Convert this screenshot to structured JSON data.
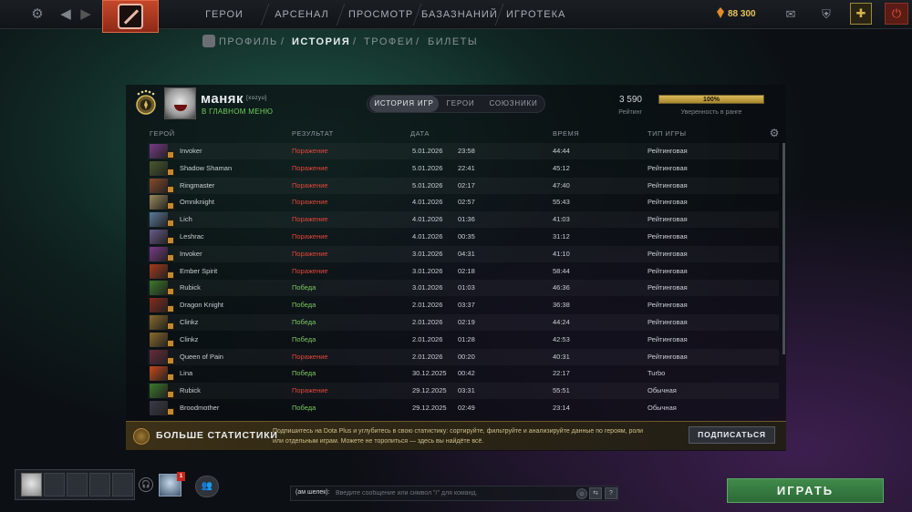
{
  "topbar": {
    "nav": [
      "ГЕРОИ",
      "АРСЕНАЛ",
      "ПРОСМОТР",
      "БАЗАЗНАНИЙ",
      "ИГРОТЕКА"
    ],
    "shards_value": "88 300",
    "icons": [
      "settings-icon",
      "back-icon",
      "dota-logo",
      "mail-icon",
      "inventory-icon",
      "dota-plus-icon",
      "power-icon"
    ]
  },
  "subnav": {
    "items": [
      "ПРОФИЛЬ",
      "ИСТОРИЯ",
      "ТРОФЕИ",
      "БИЛЕТЫ"
    ],
    "separator": "/",
    "active": "ИСТОРИЯ"
  },
  "profile": {
    "name": "маняк",
    "tag": "[xozyu]",
    "status": "В ГЛАВНОМ МЕНЮ",
    "rating": "3 590",
    "rating_label": "Рейтинг",
    "confidence": "100%",
    "confidence_value": 100,
    "confidence_label": "Уверенность в ранге"
  },
  "tabs": [
    "ИСТОРИЯ ИГР",
    "ГЕРОИ",
    "СОЮЗНИКИ"
  ],
  "table": {
    "headers": [
      "ГЕРОЙ",
      "РЕЗУЛЬТАТ",
      "ДАТА",
      "ВРЕМЯ",
      "ТИП ИГРЫ"
    ],
    "rows": [
      {
        "hero": "Invoker",
        "result": "Поражение",
        "date": "5.01.2026",
        "time": "23:58",
        "duration": "44:44",
        "type": "Рейтинговая",
        "win": false
      },
      {
        "hero": "Shadow Shaman",
        "result": "Поражение",
        "date": "5.01.2026",
        "time": "22:41",
        "duration": "45:12",
        "type": "Рейтинговая",
        "win": false
      },
      {
        "hero": "Ringmaster",
        "result": "Поражение",
        "date": "5.01.2026",
        "time": "02:17",
        "duration": "47:40",
        "type": "Рейтинговая",
        "win": false
      },
      {
        "hero": "Omniknight",
        "result": "Поражение",
        "date": "4.01.2026",
        "time": "02:57",
        "duration": "55:43",
        "type": "Рейтинговая",
        "win": false
      },
      {
        "hero": "Lich",
        "result": "Поражение",
        "date": "4.01.2026",
        "time": "01:36",
        "duration": "41:03",
        "type": "Рейтинговая",
        "win": false
      },
      {
        "hero": "Leshrac",
        "result": "Поражение",
        "date": "4.01.2026",
        "time": "00:35",
        "duration": "31:12",
        "type": "Рейтинговая",
        "win": false
      },
      {
        "hero": "Invoker",
        "result": "Поражение",
        "date": "3.01.2026",
        "time": "04:31",
        "duration": "41:10",
        "type": "Рейтинговая",
        "win": false
      },
      {
        "hero": "Ember Spirit",
        "result": "Поражение",
        "date": "3.01.2026",
        "time": "02:18",
        "duration": "58:44",
        "type": "Рейтинговая",
        "win": false
      },
      {
        "hero": "Rubick",
        "result": "Победа",
        "date": "3.01.2026",
        "time": "01:03",
        "duration": "46:36",
        "type": "Рейтинговая",
        "win": true
      },
      {
        "hero": "Dragon Knight",
        "result": "Победа",
        "date": "2.01.2026",
        "time": "03:37",
        "duration": "36:38",
        "type": "Рейтинговая",
        "win": true
      },
      {
        "hero": "Clinkz",
        "result": "Победа",
        "date": "2.01.2026",
        "time": "02:19",
        "duration": "44:24",
        "type": "Рейтинговая",
        "win": true
      },
      {
        "hero": "Clinkz",
        "result": "Победа",
        "date": "2.01.2026",
        "time": "01:28",
        "duration": "42:53",
        "type": "Рейтинговая",
        "win": true
      },
      {
        "hero": "Queen of Pain",
        "result": "Поражение",
        "date": "2.01.2026",
        "time": "00:20",
        "duration": "40:31",
        "type": "Рейтинговая",
        "win": false
      },
      {
        "hero": "Lina",
        "result": "Победа",
        "date": "30.12.2025",
        "time": "00:42",
        "duration": "22:17",
        "type": "Turbo",
        "win": true
      },
      {
        "hero": "Rubick",
        "result": "Поражение",
        "date": "29.12.2025",
        "time": "03:31",
        "duration": "55:51",
        "type": "Обычная",
        "win": false
      },
      {
        "hero": "Broodmother",
        "result": "Победа",
        "date": "29.12.2025",
        "time": "02:49",
        "duration": "23:14",
        "type": "Обычная",
        "win": true
      }
    ]
  },
  "hero_colors": [
    "#7a3a8a",
    "#4a5a2a",
    "#8a4a2a",
    "#9a8a5a",
    "#5a7a9a",
    "#6a5a8a",
    "#7a3a8a",
    "#a83a1a",
    "#3a7a2a",
    "#8a2a1a",
    "#8a6a2a",
    "#8a6a2a",
    "#6a2a3a",
    "#c84a1a",
    "#3a7a2a",
    "#3a3a4a"
  ],
  "banner": {
    "title": "БОЛЬШЕ СТАТИСТИКИ",
    "text": "Подпишитесь на Dota Plus и углубитесь в свою статистику: сортируйте, фильтруйте и анализируйте данные по героям, роли или отдельным играм. Можете не торопиться — здесь вы найдёте всё.",
    "button": "ПОДПИСАТЬСЯ"
  },
  "bottom": {
    "notification_count": "1",
    "chat_name": "(ам шелек):",
    "chat_placeholder": "Введите сообщение или символ \"/\" для команд.",
    "help": "?",
    "play_label": "ИГРАТЬ"
  },
  "colors": {
    "loss": "#e0453a",
    "win": "#79c95e",
    "play": "#3f8a4a",
    "accent_gold": "#d9b95a"
  }
}
